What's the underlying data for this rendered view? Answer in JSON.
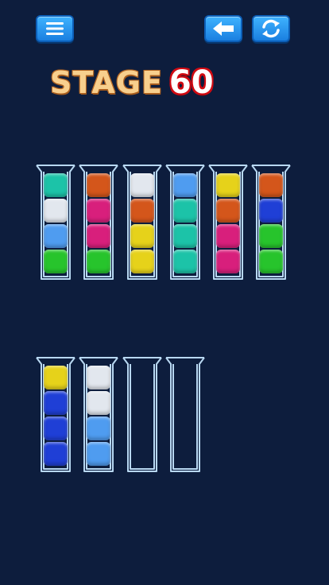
{
  "header": {
    "menu_icon": "hamburger-menu-icon",
    "undo_icon": "back-arrow-icon",
    "restart_icon": "refresh-icon"
  },
  "stage": {
    "label": "STAGE",
    "number": "60"
  },
  "colors": {
    "teal": "#1cc3a8",
    "white": "#e2e7ee",
    "lightblue": "#4f9cf0",
    "green": "#27c42c",
    "orange": "#d4561b",
    "pink": "#d81f7c",
    "yellow": "#e6d21a",
    "blue": "#1f3fd6",
    "tube_outline": "#b8d8f2"
  },
  "tubes": [
    {
      "balls": [
        "teal",
        "white",
        "lightblue",
        "green"
      ]
    },
    {
      "balls": [
        "orange",
        "pink",
        "pink",
        "green"
      ]
    },
    {
      "balls": [
        "white",
        "orange",
        "yellow",
        "yellow"
      ]
    },
    {
      "balls": [
        "lightblue",
        "teal",
        "teal",
        "teal"
      ]
    },
    {
      "balls": [
        "yellow",
        "orange",
        "pink",
        "pink"
      ]
    },
    {
      "balls": [
        "orange",
        "blue",
        "green",
        "green"
      ]
    },
    {
      "balls": [
        "yellow",
        "blue",
        "blue",
        "blue"
      ]
    },
    {
      "balls": [
        "white",
        "white",
        "lightblue",
        "lightblue"
      ]
    },
    {
      "balls": []
    },
    {
      "balls": []
    }
  ]
}
